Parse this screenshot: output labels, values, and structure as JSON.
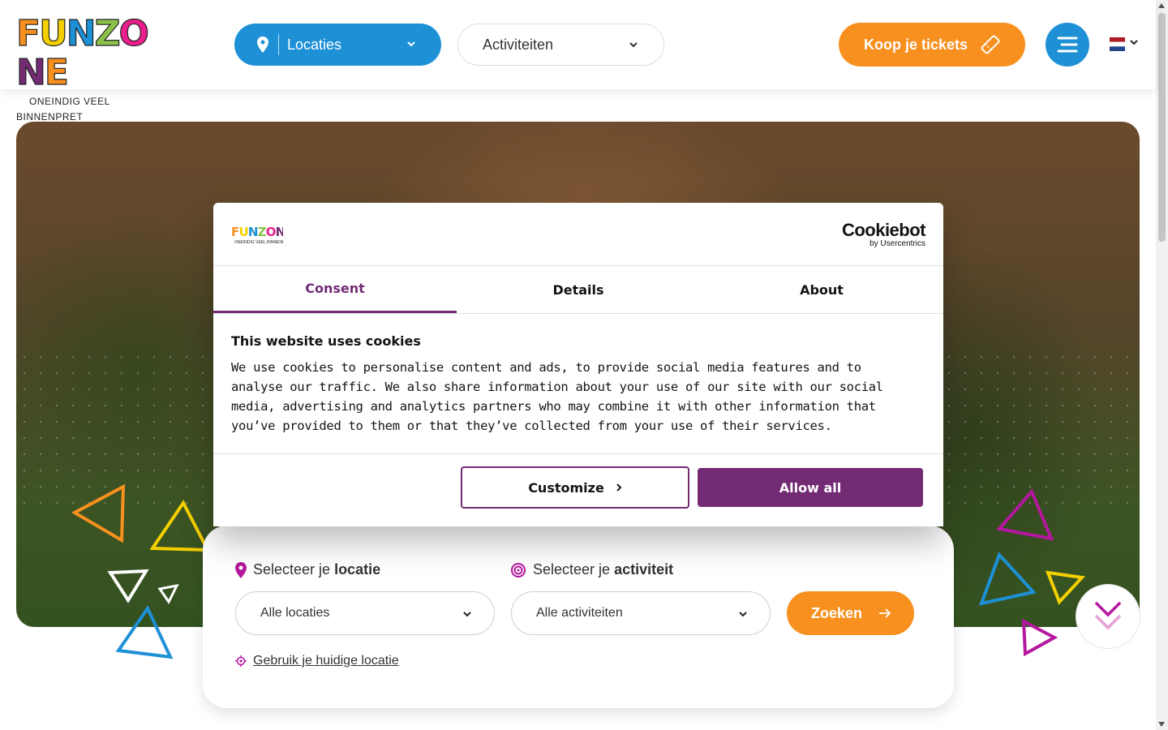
{
  "header": {
    "logo_text": "FUNZONE",
    "logo_tagline": "ONEINDIG VEEL BINNENPRET",
    "locations_label": "Locaties",
    "activities_label": "Activiteiten",
    "tickets_label": "Koop je tickets",
    "language": "NL",
    "colors": {
      "blue": "#1d90d6",
      "orange": "#f7901e"
    }
  },
  "cookie": {
    "brand": "Cookiebot",
    "brand_sub": "by Usercentrics",
    "logo_text": "FUNZONE",
    "logo_tagline": "ONEINDIG VEEL BINNENPRET",
    "tabs": [
      "Consent",
      "Details",
      "About"
    ],
    "active_tab": "Consent",
    "title": "This website uses cookies",
    "body": "We use cookies to personalise content and ads, to provide social media features and to analyse our traffic. We also share information about your use of our site with our social media, advertising and analytics partners who may combine it with other information that you’ve provided to them or that they’ve collected from your use of their services.",
    "customize_label": "Customize",
    "allow_all_label": "Allow all",
    "accent_color": "#732b74"
  },
  "search": {
    "location_label_prefix": "Selecteer je",
    "location_label_bold": "locatie",
    "activity_label_prefix": "Selecteer je",
    "activity_label_bold": "activiteit",
    "location_value": "Alle locaties",
    "activity_value": "Alle activiteiten",
    "submit_label": "Zoeken",
    "current_location_label": "Gebruik je huidige locatie"
  }
}
